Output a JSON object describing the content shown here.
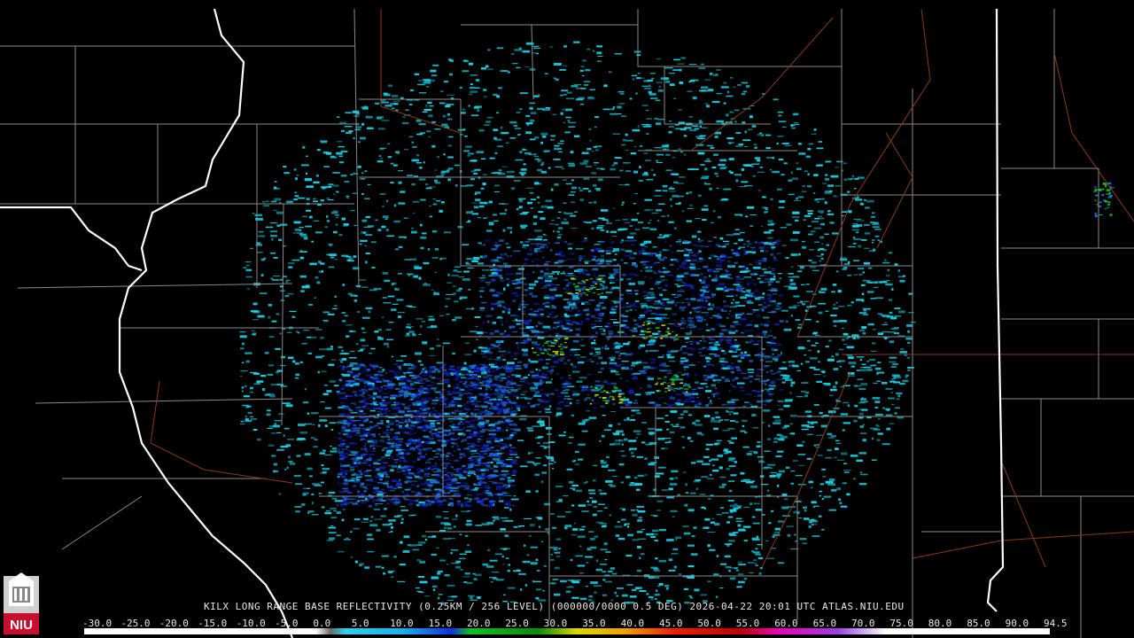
{
  "product": {
    "caption": "KILX LONG RANGE BASE REFLECTIVITY (0.25KM / 256 LEVEL) (000000/0000 0.5 DEG) 2026-04-22 20:01 UTC  ATLAS.NIU.EDU",
    "station": "KILX",
    "timestamp": "2026-04-22 20:01 UTC",
    "source": "ATLAS.NIU.EDU"
  },
  "logo": {
    "text": "NIU",
    "color": "#c8102e"
  },
  "scale": {
    "labels": [
      "-30.0",
      "-25.0",
      "-20.0",
      "-15.0",
      "-10.0",
      "-5.0",
      "0.0",
      "5.0",
      "10.0",
      "15.0",
      "20.0",
      "25.0",
      "30.0",
      "35.0",
      "40.0",
      "45.0",
      "50.0",
      "55.0",
      "60.0",
      "65.0",
      "70.0",
      "75.0",
      "80.0",
      "85.0",
      "90.0",
      "94.5"
    ]
  },
  "colors": {
    "county_lines": "#8a8a8a",
    "state_lines": "#ffffff",
    "roads": "#8b3a1a",
    "radar_site": "#000000",
    "echo_light": "#19d1e6",
    "echo_mid": "#1f6fe0",
    "echo_dark": "#1020d0",
    "echo_green": "#16c020",
    "echo_yellow": "#e6e600"
  }
}
